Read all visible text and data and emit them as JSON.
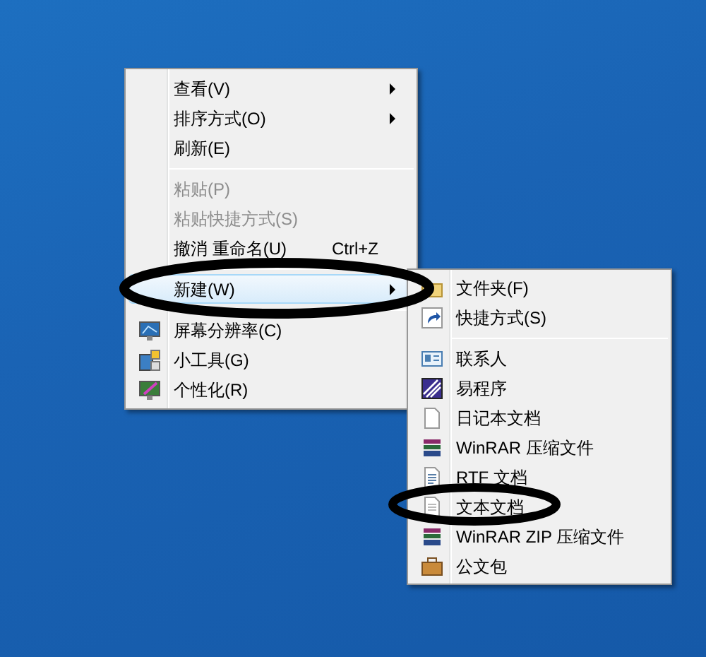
{
  "context_menu": {
    "items": [
      {
        "kind": "item",
        "label": "查看(V)",
        "submenu": true,
        "disabled": false,
        "selected": false
      },
      {
        "kind": "item",
        "label": "排序方式(O)",
        "submenu": true,
        "disabled": false,
        "selected": false
      },
      {
        "kind": "item",
        "label": "刷新(E)",
        "submenu": false,
        "disabled": false,
        "selected": false
      },
      {
        "kind": "separator"
      },
      {
        "kind": "item",
        "label": "粘贴(P)",
        "submenu": false,
        "disabled": true,
        "selected": false
      },
      {
        "kind": "item",
        "label": "粘贴快捷方式(S)",
        "submenu": false,
        "disabled": true,
        "selected": false
      },
      {
        "kind": "item",
        "label": "撤消 重命名(U)",
        "shortcut": "Ctrl+Z",
        "submenu": false,
        "disabled": false,
        "selected": false
      },
      {
        "kind": "separator"
      },
      {
        "kind": "item",
        "label": "新建(W)",
        "submenu": true,
        "disabled": false,
        "selected": true
      },
      {
        "kind": "separator"
      },
      {
        "kind": "item",
        "label": "屏幕分辨率(C)",
        "submenu": false,
        "disabled": false,
        "selected": false
      },
      {
        "kind": "item",
        "label": "小工具(G)",
        "submenu": false,
        "disabled": false,
        "selected": false
      },
      {
        "kind": "item",
        "label": "个性化(R)",
        "submenu": false,
        "disabled": false,
        "selected": false
      }
    ]
  },
  "new_submenu": {
    "items": [
      {
        "kind": "item",
        "label": "文件夹(F)"
      },
      {
        "kind": "item",
        "label": "快捷方式(S)"
      },
      {
        "kind": "separator"
      },
      {
        "kind": "item",
        "label": "联系人"
      },
      {
        "kind": "item",
        "label": "易程序"
      },
      {
        "kind": "item",
        "label": "日记本文档"
      },
      {
        "kind": "item",
        "label": "WinRAR 压缩文件"
      },
      {
        "kind": "item",
        "label": "RTF 文档"
      },
      {
        "kind": "item",
        "label": "文本文档"
      },
      {
        "kind": "item",
        "label": "WinRAR ZIP 压缩文件"
      },
      {
        "kind": "item",
        "label": "公文包"
      }
    ]
  }
}
